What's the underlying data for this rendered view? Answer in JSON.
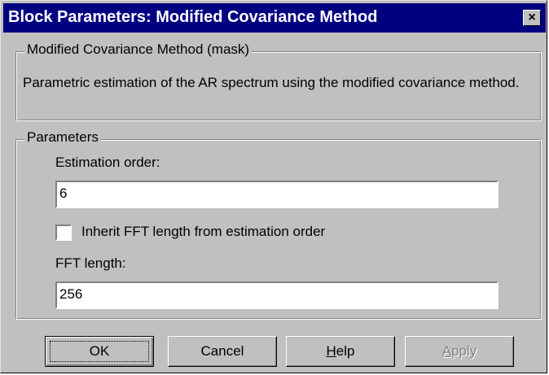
{
  "window": {
    "title": "Block Parameters: Modified Covariance Method",
    "close_glyph": "×"
  },
  "mask_group": {
    "legend": "Modified Covariance Method (mask)",
    "description": "Parametric estimation of the AR spectrum using the modified covariance method."
  },
  "params_group": {
    "legend": "Parameters",
    "estimation_order_label": "Estimation order:",
    "estimation_order_value": "6",
    "inherit_fft_label": "Inherit FFT length from estimation order",
    "inherit_fft_checked": false,
    "fft_length_label": "FFT length:",
    "fft_length_value": "256"
  },
  "buttons": {
    "ok": "OK",
    "cancel": "Cancel",
    "help_mnemonic": "H",
    "help_rest": "elp",
    "apply_mnemonic": "A",
    "apply_rest": "pply"
  },
  "colors": {
    "titlebar": "#000080",
    "face": "#c0c0c0"
  }
}
